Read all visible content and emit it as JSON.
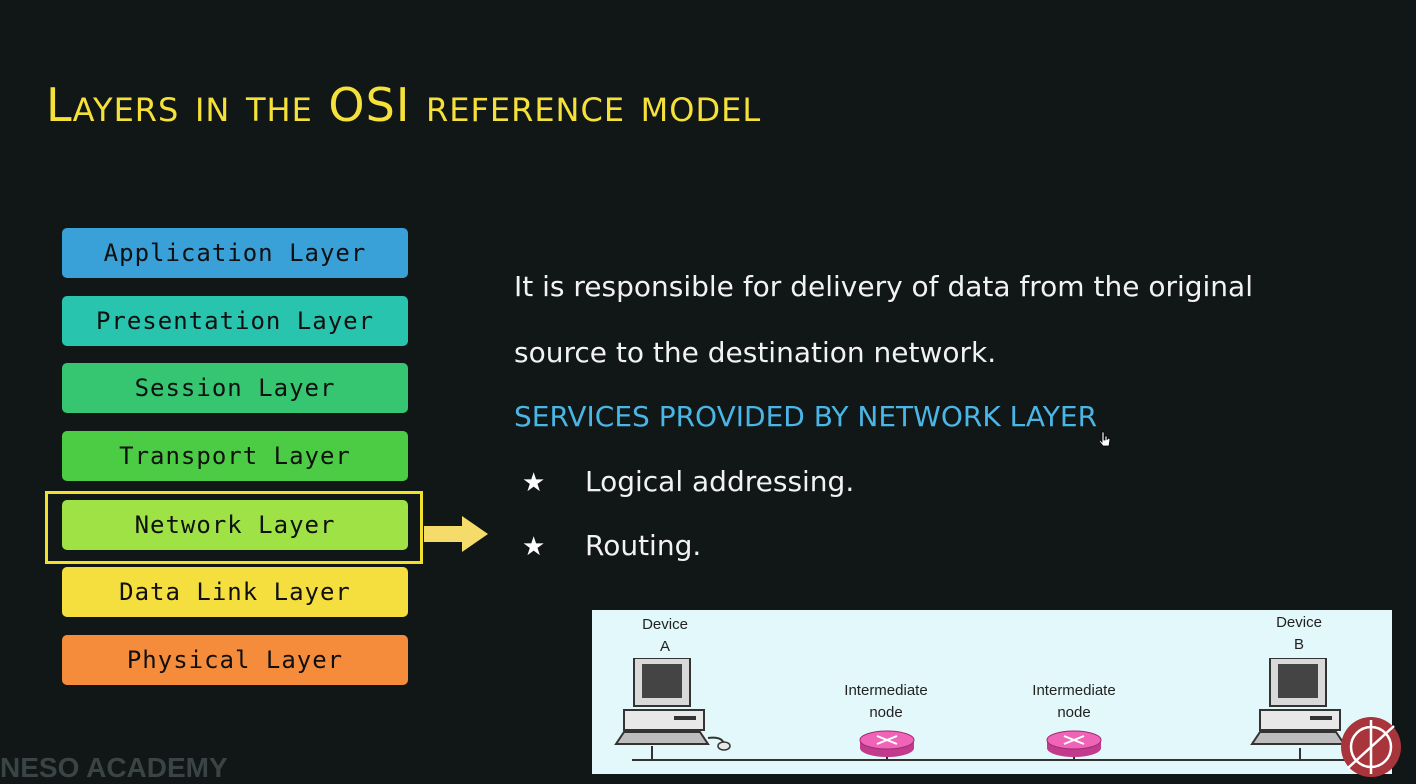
{
  "slide": {
    "title": "Layers in the OSI reference model"
  },
  "layers": [
    {
      "label": "Application Layer",
      "color": "#3aa0d8"
    },
    {
      "label": "Presentation Layer",
      "color": "#29c4ad"
    },
    {
      "label": "Session Layer",
      "color": "#36c672"
    },
    {
      "label": "Transport Layer",
      "color": "#4ccc44"
    },
    {
      "label": "Network Layer",
      "color": "#9ee245"
    },
    {
      "label": "Data Link Layer",
      "color": "#f5df3e"
    },
    {
      "label": "Physical Layer",
      "color": "#f58c3c"
    }
  ],
  "highlight": {
    "layer": "Network Layer",
    "color": "#f2e12a"
  },
  "description": {
    "line1": "It is responsible for delivery of data from the original",
    "line2": "source to the destination network."
  },
  "services": {
    "heading": "SERVICES PROVIDED BY NETWORK LAYER",
    "items": [
      "Logical addressing.",
      "Routing."
    ],
    "bullet": "★"
  },
  "figure": {
    "device_a": {
      "line1": "Device",
      "line2": "A"
    },
    "device_b": {
      "line1": "Device",
      "line2": "B"
    },
    "node1": {
      "line1": "Intermediate",
      "line2": "node"
    },
    "node2": {
      "line1": "Intermediate",
      "line2": "node"
    }
  },
  "watermark": "NESO ACADEMY",
  "icons": [
    "computer-icon",
    "router-icon",
    "logo-icon",
    "cursor-icon"
  ]
}
